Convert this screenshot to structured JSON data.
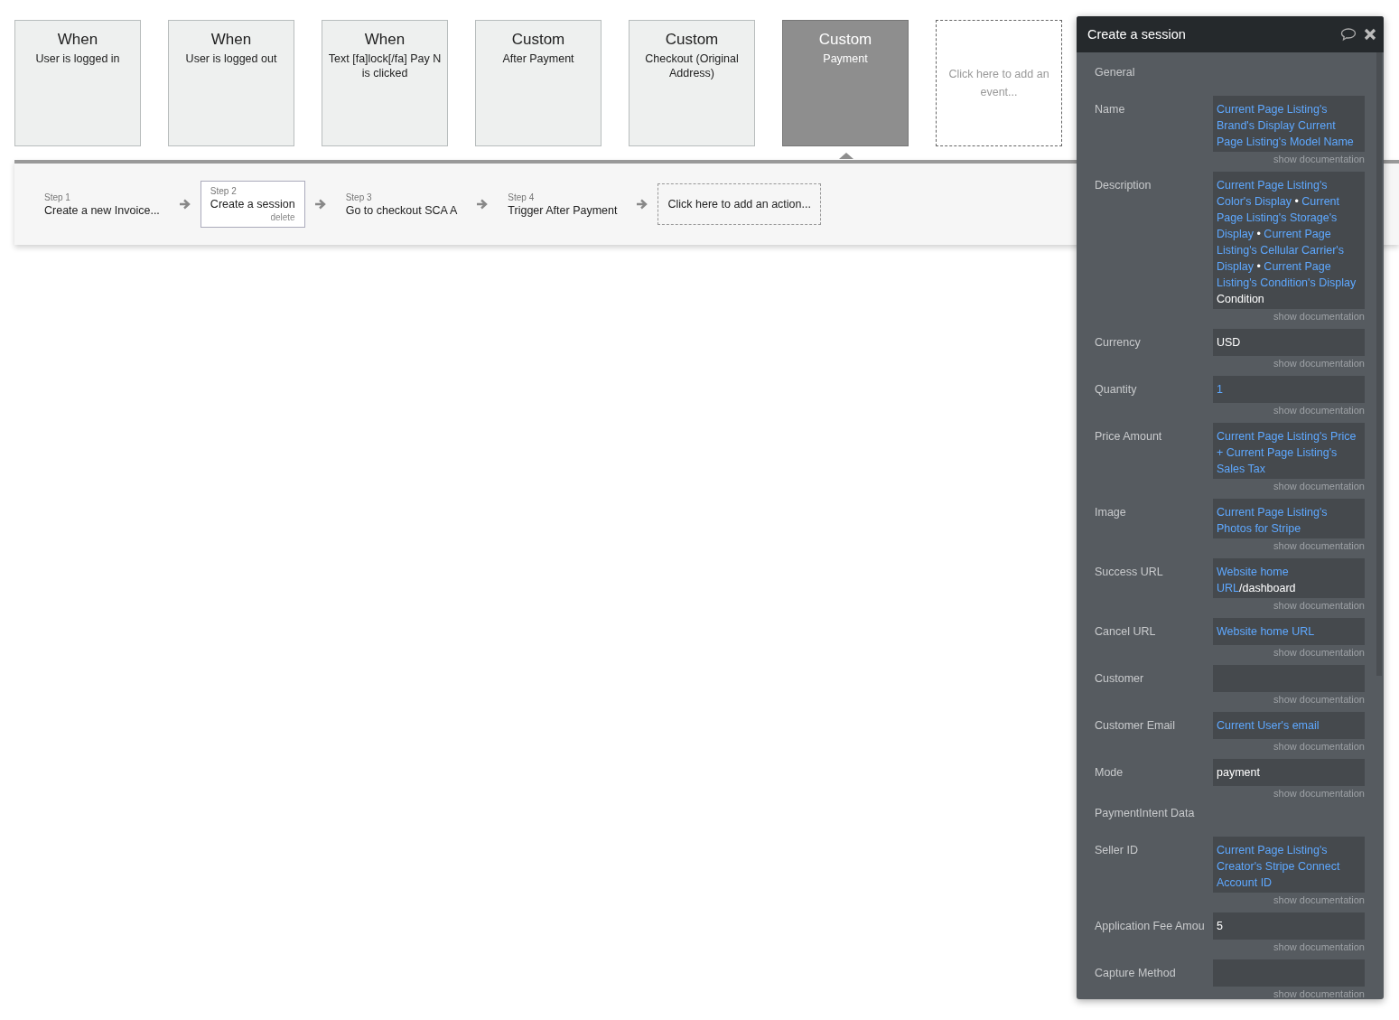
{
  "events": [
    {
      "kind": "When",
      "description": "User is logged in",
      "selected": false
    },
    {
      "kind": "When",
      "description": "User is logged out",
      "selected": false
    },
    {
      "kind": "When",
      "description": "Text [fa]lock[/fa] Pay N is clicked",
      "selected": false
    },
    {
      "kind": "Custom",
      "description": "After Payment",
      "selected": false
    },
    {
      "kind": "Custom",
      "description": "Checkout (Original Address)",
      "selected": false
    },
    {
      "kind": "Custom",
      "description": "Payment",
      "selected": true
    }
  ],
  "add_event": "Click here to add an event...",
  "steps": [
    {
      "step": "Step 1",
      "action": "Create a new Invoice...",
      "selected": false
    },
    {
      "step": "Step 2",
      "action": "Create a session",
      "selected": true,
      "delete": "delete"
    },
    {
      "step": "Step 3",
      "action": "Go to checkout SCA A",
      "selected": false
    },
    {
      "step": "Step 4",
      "action": "Trigger After Payment",
      "selected": false
    }
  ],
  "add_action": "Click here to add an action...",
  "panel": {
    "title": "Create a session",
    "rows": [
      {
        "kind": "section",
        "label": "General"
      },
      {
        "kind": "field",
        "label": "Name",
        "doc": "show documentation",
        "value": [
          {
            "kind": "dynamic",
            "text": "Current Page Listing's Brand's Display"
          },
          {
            "kind": "dynamic",
            "text": "Current Page Listing's Model Name"
          }
        ]
      },
      {
        "kind": "field",
        "label": "Description",
        "doc": "show documentation",
        "value": [
          {
            "kind": "dynamic",
            "text": "Current Page Listing's Color's Display"
          },
          {
            "kind": "static",
            "text": "•"
          },
          {
            "kind": "dynamic",
            "text": "Current Page Listing's Storage's Display"
          },
          {
            "kind": "static",
            "text": "•"
          },
          {
            "kind": "dynamic",
            "text": "Current Page Listing's Cellular Carrier's Display"
          },
          {
            "kind": "static",
            "text": "•"
          },
          {
            "kind": "dynamic",
            "text": "Current Page Listing's Condition's Display"
          },
          {
            "kind": "static",
            "text": "Condition"
          }
        ]
      },
      {
        "kind": "field",
        "label": "Currency",
        "doc": "show documentation",
        "value": [
          {
            "kind": "static",
            "text": "USD"
          }
        ]
      },
      {
        "kind": "field",
        "label": "Quantity",
        "doc": "show documentation",
        "value": [
          {
            "kind": "dynamic",
            "text": "1"
          }
        ]
      },
      {
        "kind": "field",
        "label": "Price Amount",
        "doc": "show documentation",
        "value": [
          {
            "kind": "dynamic",
            "text": "Current Page Listing's Price + Current Page Listing's Sales Tax"
          }
        ]
      },
      {
        "kind": "field",
        "label": "Image",
        "doc": "show documentation",
        "value": [
          {
            "kind": "dynamic",
            "text": "Current Page Listing's Photos for Stripe"
          }
        ]
      },
      {
        "kind": "field",
        "label": "Success URL",
        "doc": "show documentation",
        "value": [
          {
            "kind": "dynamic",
            "text": "Website home URL"
          },
          {
            "kind": "static",
            "text": "/dashboard",
            "joined": true
          }
        ]
      },
      {
        "kind": "field",
        "label": "Cancel URL",
        "doc": "show documentation",
        "value": [
          {
            "kind": "dynamic",
            "text": "Website home URL"
          }
        ]
      },
      {
        "kind": "field",
        "label": "Customer",
        "doc": "show documentation",
        "value": []
      },
      {
        "kind": "field",
        "label": "Customer Email",
        "doc": "show documentation",
        "value": [
          {
            "kind": "dynamic",
            "text": "Current User's email"
          }
        ]
      },
      {
        "kind": "field",
        "label": "Mode",
        "doc": "show documentation",
        "value": [
          {
            "kind": "static",
            "text": "payment"
          }
        ]
      },
      {
        "kind": "section",
        "label": "PaymentIntent Data"
      },
      {
        "kind": "field",
        "label": "Seller ID",
        "doc": "show documentation",
        "value": [
          {
            "kind": "dynamic",
            "text": "Current Page Listing's Creator's Stripe Connect Account ID"
          }
        ]
      },
      {
        "kind": "field",
        "label": "Application Fee Amou",
        "doc": "show documentation",
        "value": [
          {
            "kind": "static",
            "text": "5"
          }
        ]
      },
      {
        "kind": "field",
        "label": "Capture Method",
        "doc": "show documentation",
        "value": []
      }
    ]
  }
}
